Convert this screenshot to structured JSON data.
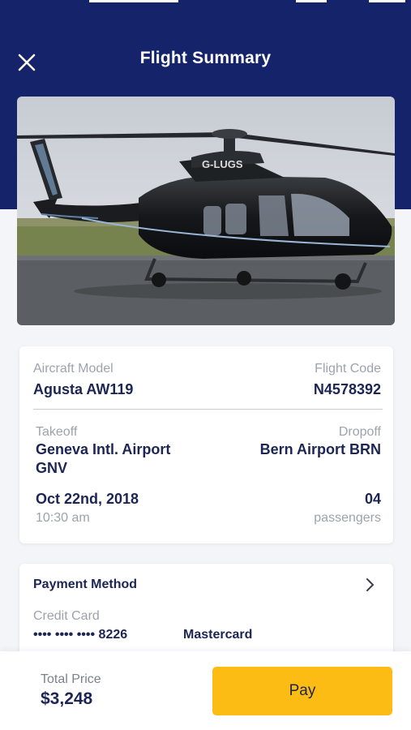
{
  "header": {
    "title": "Flight Summary",
    "close_icon": "close-icon",
    "background_color": "#15246a"
  },
  "hero": {
    "icon": "helicopter-photo",
    "registration_text": "G-LUGS"
  },
  "flight": {
    "aircraft_model_label": "Aircraft Model",
    "aircraft_model": "Agusta AW119",
    "flight_code_label": "Flight Code",
    "flight_code": "N4578392",
    "takeoff_label": "Takeoff",
    "takeoff_line1": "Geneva Intl. Airport",
    "takeoff_line2": "GNV",
    "dropoff_label": "Dropoff",
    "dropoff": "Bern Airport BRN",
    "date": "Oct 22nd, 2018",
    "time": "10:30 am",
    "passenger_count": "04",
    "passengers_label": "passengers"
  },
  "payment": {
    "title": "Payment Method",
    "chevron_icon": "chevron-right-icon",
    "method_label": "Credit Card",
    "card_number": "•••• •••• •••• 8226",
    "card_brand": "Mastercard"
  },
  "footer": {
    "total_label": "Total Price",
    "total_value": "$3,248",
    "pay_label": "Pay",
    "pay_color": "#fdbc13"
  }
}
